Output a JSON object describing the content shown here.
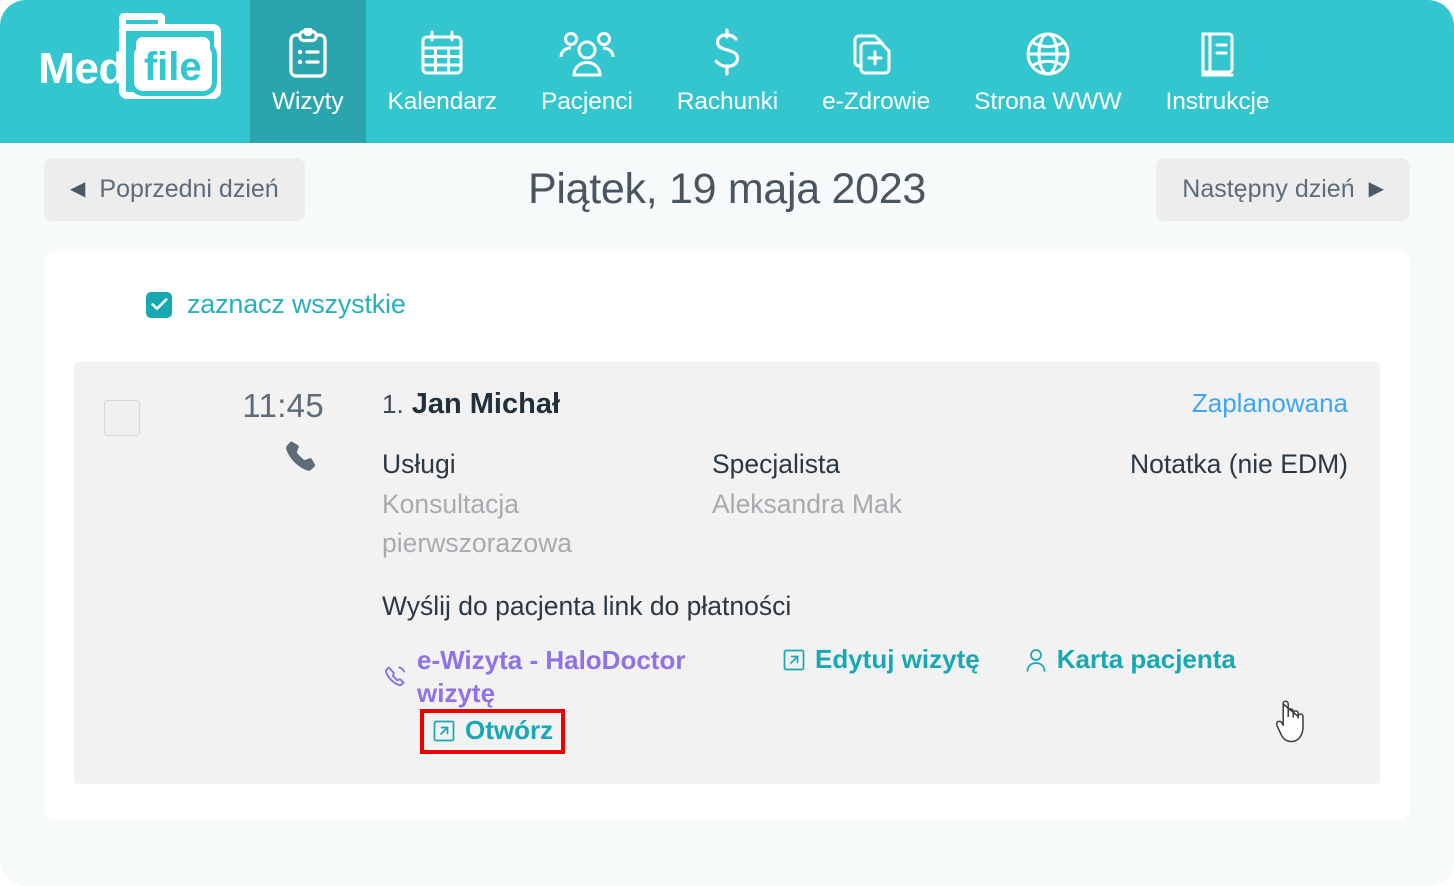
{
  "brand": {
    "word": "Med",
    "badge": "file"
  },
  "nav": {
    "items": [
      {
        "label": "Wizyty",
        "icon": "clipboard-icon",
        "active": true
      },
      {
        "label": "Kalendarz",
        "icon": "calendar-icon",
        "active": false
      },
      {
        "label": "Pacjenci",
        "icon": "users-icon",
        "active": false
      },
      {
        "label": "Rachunki",
        "icon": "dollar-icon",
        "active": false
      },
      {
        "label": "e-Zdrowie",
        "icon": "health-doc-icon",
        "active": false
      },
      {
        "label": "Strona WWW",
        "icon": "globe-icon",
        "active": false
      },
      {
        "label": "Instrukcje",
        "icon": "book-icon",
        "active": false
      }
    ]
  },
  "datebar": {
    "prev_label": "Poprzedni dzień",
    "prev_icon": "chevron-left-icon",
    "title": "Piątek, 19 maja 2023",
    "next_label": "Następny dzień",
    "next_icon": "chevron-right-icon"
  },
  "select_all": {
    "label": "zaznacz wszystkie",
    "checked": true,
    "icon": "check-icon"
  },
  "appointment": {
    "checkbox_checked": false,
    "time": "11:45",
    "channel_icon": "phone-icon",
    "index": "1.",
    "patient_name": "Jan Michał",
    "status": "Zaplanowana",
    "services_head": "Usługi",
    "services_value": "Konsultacja pierwszorazowa",
    "specialist_head": "Specjalista",
    "specialist_value": "Aleksandra Mak",
    "note_head": "Notatka (nie EDM)",
    "payment_link": "Wyślij do pacjenta link do płatności",
    "actions": [
      {
        "label": "e-Wizyta - HaloDoctor wizytę",
        "icon": "phone-call-icon",
        "name": "e-wizyta-halodoctor"
      },
      {
        "label": "Edytuj wizytę",
        "icon": "external-link-icon",
        "name": "edytuj-wizyte"
      },
      {
        "label": "Karta pacjenta",
        "icon": "user-icon",
        "name": "karta-pacjenta"
      },
      {
        "label": "Otwórz",
        "icon": "external-link-icon",
        "name": "otworz"
      }
    ]
  },
  "colors": {
    "nav_bg": "#33c6cf",
    "nav_active": "#2aa5ae",
    "teal_link": "#17a8b4",
    "status_blue": "#3da5f4",
    "purple_link": "#8d73e6",
    "highlight_red": "#ef0000",
    "page_bg": "#f6fafb",
    "row_bg": "#f2f2f2"
  }
}
